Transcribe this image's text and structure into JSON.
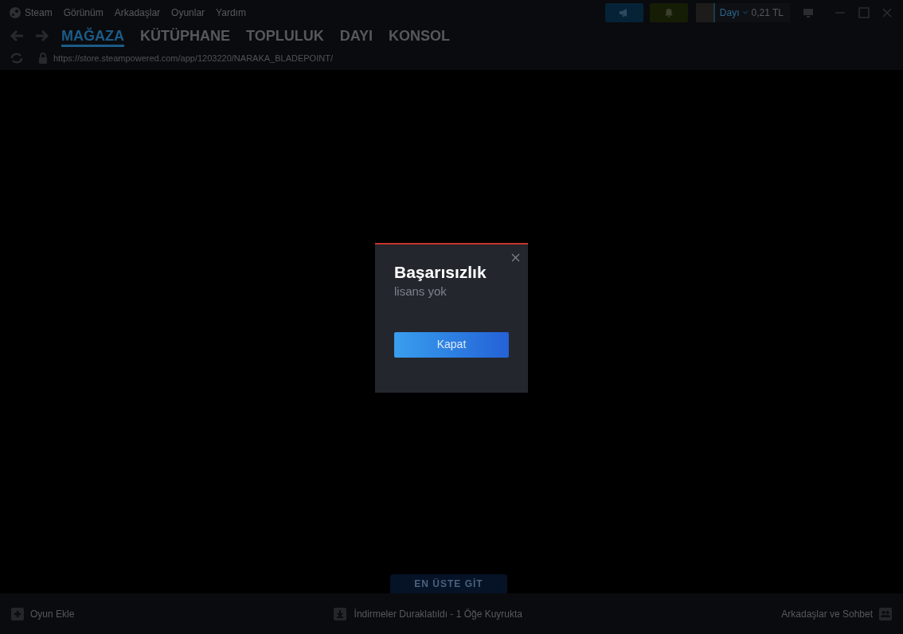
{
  "menu": [
    "Steam",
    "Görünüm",
    "Arkadaşlar",
    "Oyunlar",
    "Yardım"
  ],
  "user": {
    "name": "Dayı",
    "balance": "0,21 TL"
  },
  "nav_tabs": [
    {
      "label": "MAĞAZA",
      "selected": true
    },
    {
      "label": "KÜTÜPHANE",
      "selected": false
    },
    {
      "label": "TOPLULUK",
      "selected": false
    },
    {
      "label": "DAYI",
      "selected": false
    },
    {
      "label": "KONSOL",
      "selected": false
    }
  ],
  "url": "https://store.steampowered.com/app/1203220/NARAKA_BLADEPOINT/",
  "dialog": {
    "title": "Başarısızlık",
    "message": "lisans yok",
    "button": "Kapat"
  },
  "scroll_top_button": "EN ÜSTE GİT",
  "status_bar": {
    "add_game": "Oyun Ekle",
    "downloads": "İndirmeler Duraklatıldı - 1 Öğe Kuyrukta",
    "friends": "Arkadaşlar ve Sohbet"
  }
}
